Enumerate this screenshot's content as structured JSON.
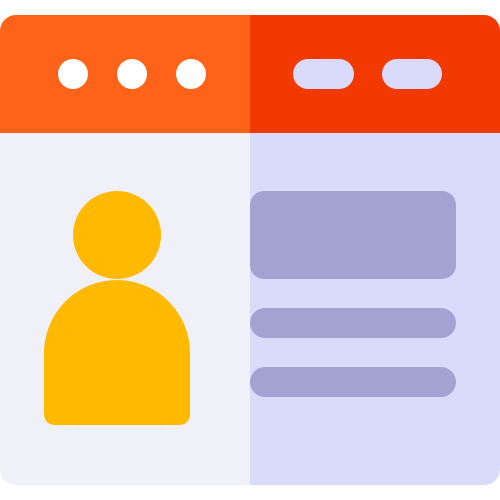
{
  "icon": {
    "name": "profile-webpage-icon",
    "colors": {
      "titlebar_left": "#FF6319",
      "titlebar_right": "#F23A00",
      "body_left": "#F0F0F8",
      "body_right": "#DADAFA",
      "window_dot": "#FFFFFF",
      "titlebar_pill": "#DADAFA",
      "avatar": "#FFBA00",
      "content_block": "#A3A3D1"
    }
  }
}
